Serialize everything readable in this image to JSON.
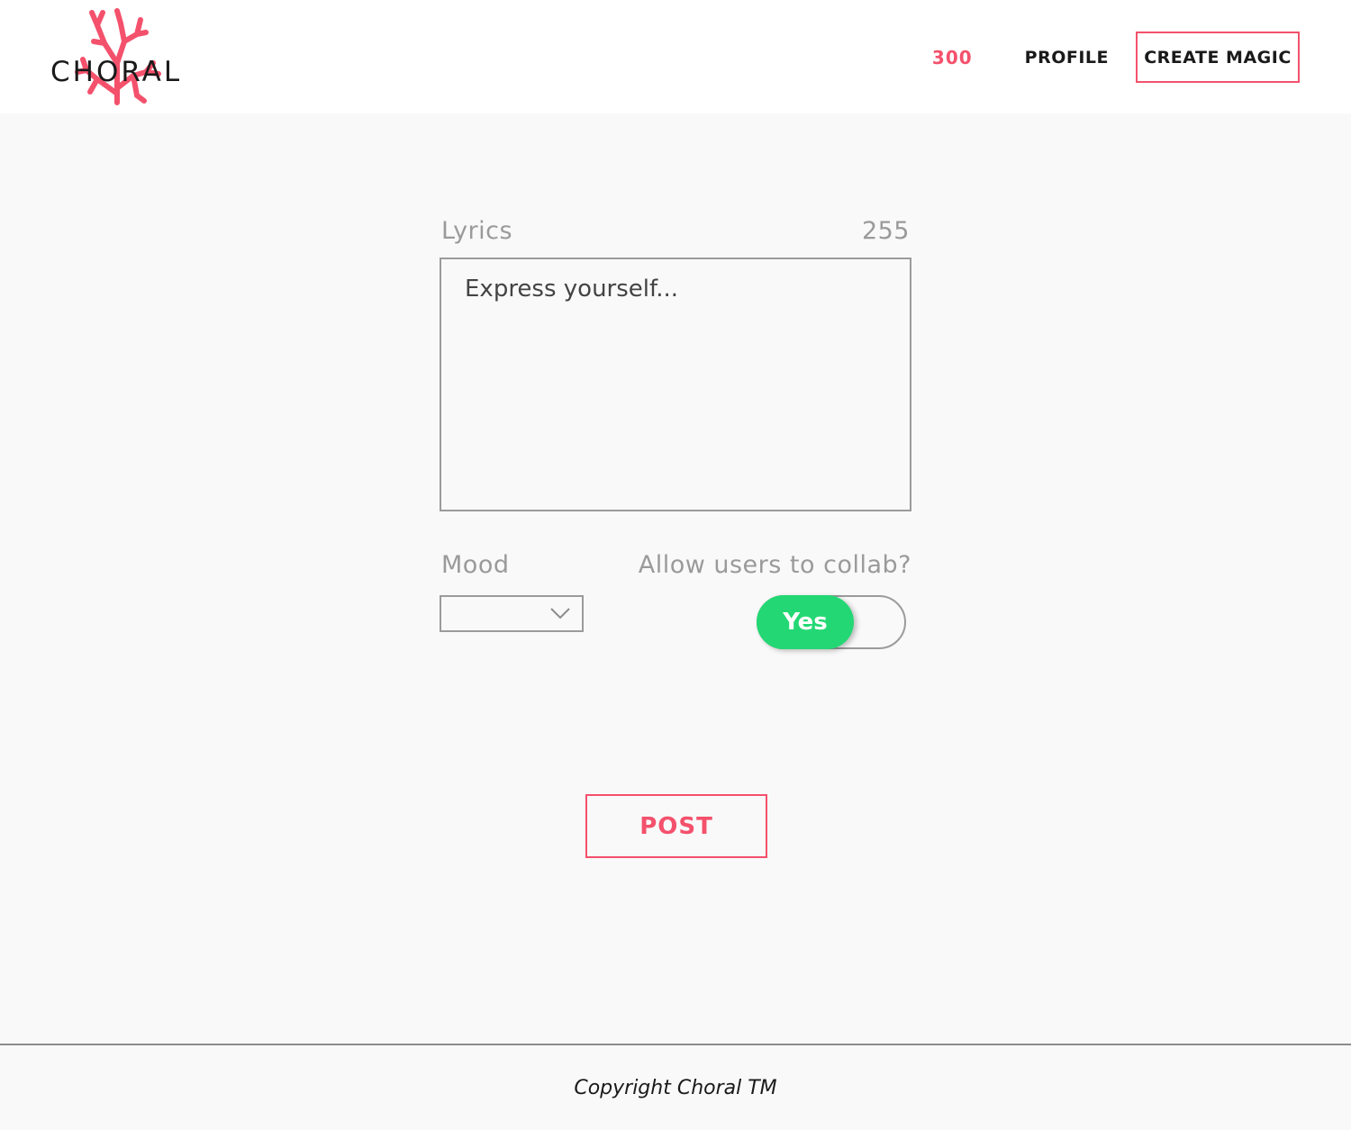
{
  "colors": {
    "accent": "#f4516c",
    "toggle_on": "#23d874",
    "text_dark": "#1a1a1a",
    "label_gray": "#9a9a9a",
    "background": "#f9f9f9"
  },
  "header": {
    "logo_text": "CHORAL",
    "logo_icon": "coral-icon",
    "count": "300",
    "profile_label": "PROFILE",
    "create_label": "CREATE MAGIC"
  },
  "form": {
    "lyrics_label": "Lyrics",
    "lyrics_counter": "255",
    "lyrics_value": "",
    "lyrics_placeholder": "Express yourself...",
    "mood_label": "Mood",
    "mood_value": "",
    "collab_label": "Allow users to collab?",
    "collab_toggle_label": "Yes",
    "collab_enabled": true,
    "post_label": "POST"
  },
  "footer": {
    "copyright": "Copyright Choral TM"
  }
}
